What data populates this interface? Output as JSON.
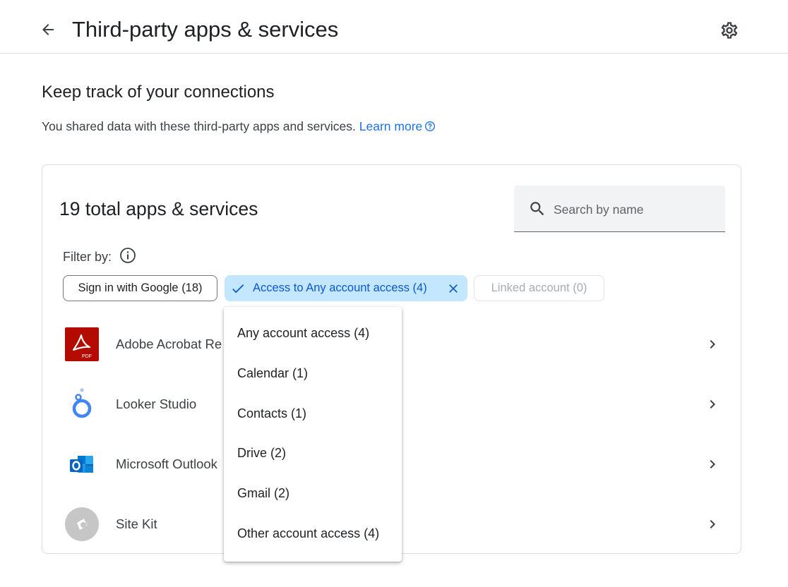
{
  "header": {
    "back_icon": "arrow-back-icon",
    "title": "Third-party apps & services",
    "settings_icon": "gear-icon"
  },
  "intro": {
    "heading": "Keep track of your connections",
    "description": "You shared data with these third-party apps and services.",
    "learn_more": "Learn more",
    "help_icon": "help-circle-icon"
  },
  "card": {
    "title": "19 total apps & services",
    "search": {
      "placeholder": "Search by name",
      "value": "",
      "icon": "search-icon"
    },
    "filter": {
      "label": "Filter by:",
      "info_icon": "info-icon",
      "chips": [
        {
          "label": "Sign in with Google (18)",
          "state": "unselected"
        },
        {
          "label": "Access to Any account access (4)",
          "state": "selected",
          "leading_icon": "check-icon",
          "trailing_icon": "close-icon"
        },
        {
          "label": "Linked account (0)",
          "state": "disabled"
        }
      ]
    },
    "apps": [
      {
        "name": "Adobe Acrobat Re",
        "icon": "adobe-acrobat-icon"
      },
      {
        "name": "Looker Studio",
        "icon": "looker-studio-icon"
      },
      {
        "name": "Microsoft Outlook",
        "icon": "outlook-icon"
      },
      {
        "name": "Site Kit",
        "icon": "site-kit-icon"
      }
    ]
  },
  "dropdown": {
    "items": [
      "Any account access (4)",
      "Calendar (1)",
      "Contacts (1)",
      "Drive (2)",
      "Gmail (2)",
      "Other account access (4)"
    ]
  },
  "colors": {
    "accent": "#1a73e8",
    "chip_selected_bg": "#c2e7ff",
    "chip_selected_text": "#0b57d0",
    "adobe_red": "#b30b00",
    "outlook_blue": "#0a64c4"
  }
}
